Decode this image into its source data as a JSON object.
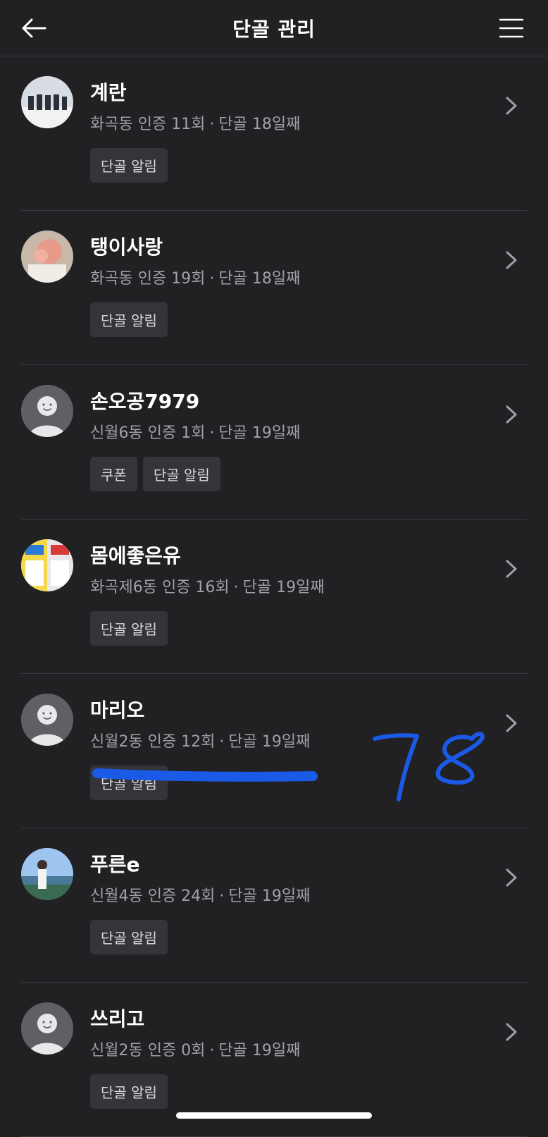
{
  "header": {
    "title": "단골 관리",
    "back_icon": "arrow-left-icon",
    "menu_icon": "hamburger-menu-icon"
  },
  "colors": {
    "background": "#212124",
    "divider": "#3a3b40",
    "tag_bg": "#33353a",
    "secondary_text": "#a0a1a6",
    "annotation": "#1a5ae6"
  },
  "customers": [
    {
      "name": "계란",
      "location": "화곡동 인증 11회",
      "regular": "단골 18일째",
      "tags": [
        "단골 알림"
      ],
      "avatar": "photo"
    },
    {
      "name": "탱이사랑",
      "location": "화곡동 인증 19회",
      "regular": "단골 18일째",
      "tags": [
        "단골 알림"
      ],
      "avatar": "photo"
    },
    {
      "name": "손오공7979",
      "location": "신월6동 인증 1회",
      "regular": "단골 19일째",
      "tags": [
        "쿠폰",
        "단골 알림"
      ],
      "avatar": "default"
    },
    {
      "name": "몸에좋은유",
      "location": "화곡제6동 인증 16회",
      "regular": "단골 19일째",
      "tags": [
        "단골 알림"
      ],
      "avatar": "photo"
    },
    {
      "name": "마리오",
      "location": "신월2동 인증 12회",
      "regular": "단골 19일째",
      "tags": [
        "단골 알림"
      ],
      "avatar": "default"
    },
    {
      "name": "푸른e",
      "location": "신월4동 인증 24회",
      "regular": "단골 19일째",
      "tags": [
        "단골 알림"
      ],
      "avatar": "photo"
    },
    {
      "name": "쓰리고",
      "location": "신월2동 인증 0회",
      "regular": "단골 19일째",
      "tags": [
        "단골 알림"
      ],
      "avatar": "default"
    }
  ],
  "annotation": {
    "handwritten_text": "78"
  }
}
